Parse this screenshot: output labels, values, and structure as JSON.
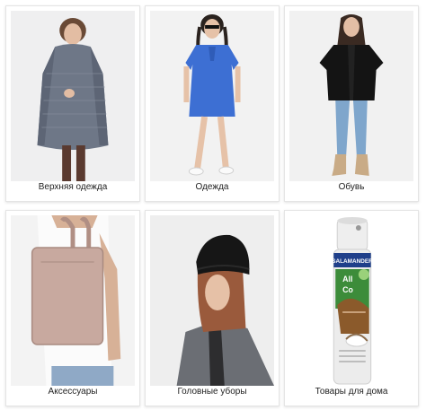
{
  "categories": [
    {
      "label": "Верхняя одежда",
      "image": "fur-coat-photo"
    },
    {
      "label": "Одежда",
      "image": "blue-dress-photo"
    },
    {
      "label": "Обувь",
      "image": "black-coat-boots-photo"
    },
    {
      "label": "Аксессуары",
      "image": "leather-backpack-photo"
    },
    {
      "label": "Головные уборы",
      "image": "black-beanie-photo"
    },
    {
      "label": "Товары для дома",
      "image": "spray-can-photo"
    }
  ],
  "spray_can": {
    "brand": "SALAMANDER",
    "line1": "All",
    "line2": "Co"
  },
  "colors": {
    "card_border": "#e4e4e4",
    "caption_text": "#222222",
    "photo_bg": "#eeeeee"
  }
}
